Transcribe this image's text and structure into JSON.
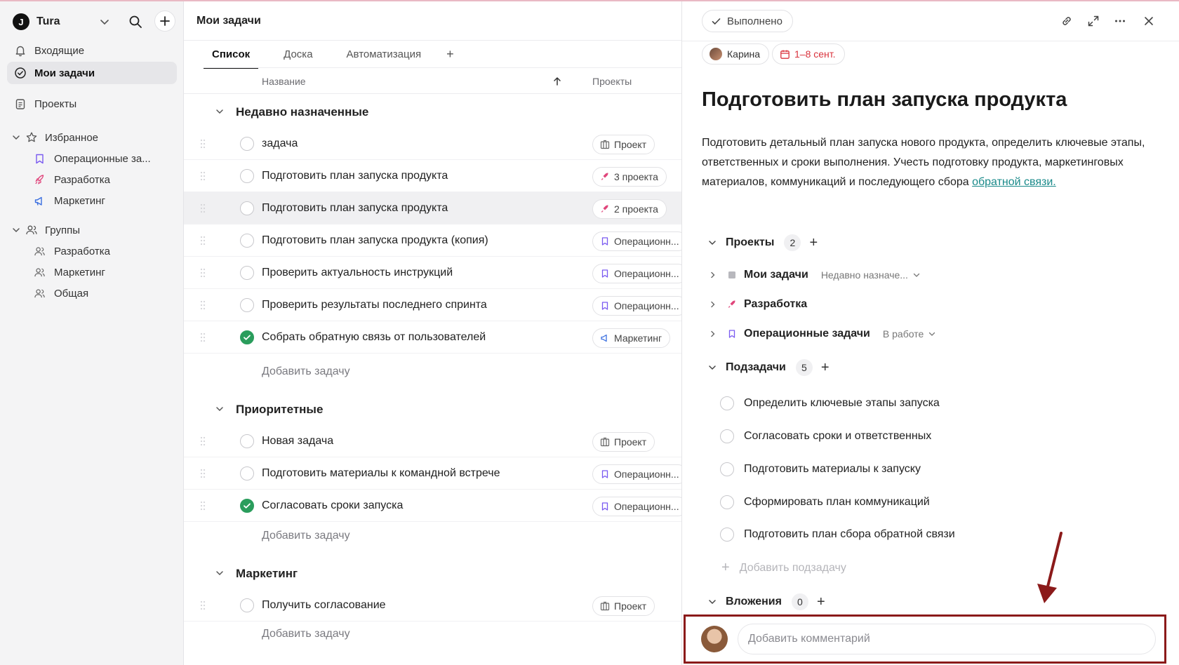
{
  "workspace": {
    "logo": "J",
    "name": "Tura"
  },
  "sidebar": {
    "inbox": "Входящие",
    "my_tasks": "Мои задачи",
    "projects": "Проекты",
    "favorites": {
      "label": "Избранное",
      "items": [
        "Операционные за...",
        "Разработка",
        "Маркетинг"
      ]
    },
    "groups": {
      "label": "Группы",
      "items": [
        "Разработка",
        "Маркетинг",
        "Общая"
      ]
    }
  },
  "main": {
    "title": "Мои задачи",
    "tabs": [
      "Список",
      "Доска",
      "Автоматизация"
    ],
    "tab_add": "+",
    "columns": {
      "name": "Название",
      "projects": "Проекты"
    },
    "add_task": "Добавить задачу",
    "groups": [
      {
        "title": "Недавно назначенные",
        "tasks": [
          {
            "name": "задача",
            "chip": "Проект",
            "chip_icon": "building-icon",
            "done": false
          },
          {
            "name": "Подготовить план запуска продукта",
            "chip": "3 проекта",
            "chip_icon": "rocket-icon",
            "done": false
          },
          {
            "name": "Подготовить план запуска продукта",
            "chip": "2 проекта",
            "chip_icon": "rocket-icon",
            "done": false,
            "highlighted": true
          },
          {
            "name": "Подготовить план запуска продукта (копия)",
            "chip": "Операционн...",
            "chip_icon": "bookmark-icon",
            "done": false
          },
          {
            "name": "Проверить актуальность инструкций",
            "chip": "Операционн...",
            "chip_icon": "bookmark-icon",
            "done": false
          },
          {
            "name": "Проверить результаты последнего спринта",
            "chip": "Операционн...",
            "chip_icon": "bookmark-icon",
            "done": false
          },
          {
            "name": "Собрать обратную связь от пользователей",
            "chip": "Маркетинг",
            "chip_icon": "megaphone-icon",
            "done": true
          }
        ]
      },
      {
        "title": "Приоритетные",
        "tasks": [
          {
            "name": "Новая задача",
            "chip": "Проект",
            "chip_icon": "building-icon",
            "done": false
          },
          {
            "name": "Подготовить материалы к командной встрече",
            "chip": "Операционн...",
            "chip_icon": "bookmark-icon",
            "done": false
          },
          {
            "name": "Согласовать сроки запуска",
            "chip": "Операционн...",
            "chip_icon": "bookmark-icon",
            "done": true
          }
        ]
      },
      {
        "title": "Маркетинг",
        "tasks": [
          {
            "name": "Получить согласование",
            "chip": "Проект",
            "chip_icon": "building-icon",
            "done": false
          }
        ]
      }
    ]
  },
  "detail": {
    "done_label": "Выполнено",
    "assignee": "Карина",
    "dates": "1–8 сент.",
    "title": "Подготовить план запуска продукта",
    "description": "Подготовить детальный план запуска нового продукта, определить ключевые этапы, ответственных и сроки выполнения. Учесть подготовку продукта, маркетинговых материалов, коммуникаций и последующего сбора ",
    "description_link": "обратной связи.",
    "projects_section": {
      "label": "Проекты",
      "count": "2"
    },
    "projects": [
      {
        "name": "Мои задачи",
        "status": "Недавно назначе...",
        "icon": "square-icon"
      },
      {
        "name": "Разработка",
        "status": "",
        "icon": "rocket-icon"
      },
      {
        "name": "Операционные задачи",
        "status": "В работе",
        "icon": "bookmark-icon"
      }
    ],
    "subtasks_section": {
      "label": "Подзадачи",
      "count": "5"
    },
    "subtasks": [
      "Определить ключевые этапы запуска",
      "Согласовать сроки и ответственных",
      "Подготовить материалы к запуску",
      "Сформировать план коммуникаций",
      "Подготовить план сбора обратной связи"
    ],
    "add_subtask": "Добавить подзадачу",
    "attachments_section": {
      "label": "Вложения",
      "count": "0"
    },
    "comment_placeholder": "Добавить комментарий"
  },
  "colors": {
    "accent_done": "#2a9d5c",
    "date_red": "#d9323c",
    "link": "#1a8a8a",
    "annotation": "#8b1a1a"
  }
}
